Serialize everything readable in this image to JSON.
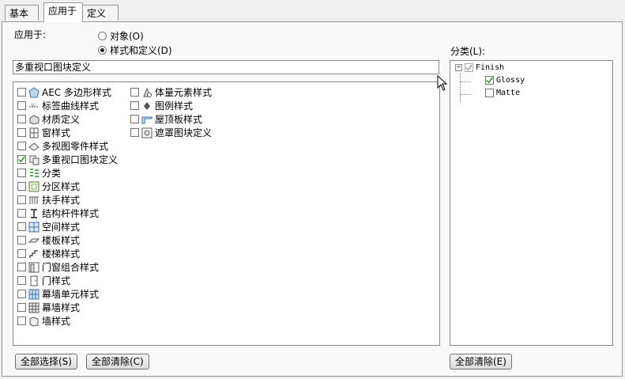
{
  "tabs": [
    {
      "label": "基本"
    },
    {
      "label": "应用于"
    },
    {
      "label": "定义"
    }
  ],
  "apply_to": {
    "label": "应用于:",
    "options": [
      {
        "label": "对象(O)",
        "selected": false
      },
      {
        "label": "样式和定义(D)",
        "selected": true
      }
    ]
  },
  "current_style": "多重视口图块定义",
  "style_list": {
    "col1": [
      {
        "label": "AEC 多边形样式",
        "checked": false,
        "icon": "polygon-icon"
      },
      {
        "label": "标签曲线样式",
        "checked": false,
        "icon": "label-curve-icon"
      },
      {
        "label": "材质定义",
        "checked": false,
        "icon": "material-icon"
      },
      {
        "label": "窗样式",
        "checked": false,
        "icon": "window-icon"
      },
      {
        "label": "多视图零件样式",
        "checked": false,
        "icon": "multiview-part-icon"
      },
      {
        "label": "多重视口图块定义",
        "checked": true,
        "icon": "mvblock-icon"
      },
      {
        "label": "分类",
        "checked": false,
        "icon": "classification-icon"
      },
      {
        "label": "分区样式",
        "checked": false,
        "icon": "zone-icon"
      },
      {
        "label": "扶手样式",
        "checked": false,
        "icon": "railing-icon"
      },
      {
        "label": "结构杆件样式",
        "checked": false,
        "icon": "structural-member-icon"
      },
      {
        "label": "空间样式",
        "checked": false,
        "icon": "space-icon"
      },
      {
        "label": "楼板样式",
        "checked": false,
        "icon": "slab-icon"
      },
      {
        "label": "楼梯样式",
        "checked": false,
        "icon": "stair-icon"
      },
      {
        "label": "门窗组合样式",
        "checked": false,
        "icon": "door-window-assembly-icon"
      },
      {
        "label": "门样式",
        "checked": false,
        "icon": "door-icon"
      },
      {
        "label": "幕墙单元样式",
        "checked": false,
        "icon": "curtain-wall-unit-icon"
      },
      {
        "label": "幕墙样式",
        "checked": false,
        "icon": "curtain-wall-icon"
      },
      {
        "label": "墙样式",
        "checked": false,
        "icon": "wall-icon"
      }
    ],
    "col2": [
      {
        "label": "体量元素样式",
        "checked": false,
        "icon": "mass-element-icon"
      },
      {
        "label": "图例样式",
        "checked": false,
        "icon": "legend-icon"
      },
      {
        "label": "屋顶板样式",
        "checked": false,
        "icon": "roof-slab-icon"
      },
      {
        "label": "遮罩图块定义",
        "checked": false,
        "icon": "mask-block-icon"
      }
    ]
  },
  "classification": {
    "label": "分类(L):",
    "root": {
      "label": "Finish",
      "checked": true,
      "expanded": true
    },
    "children": [
      {
        "label": "Glossy",
        "checked": true
      },
      {
        "label": "Matte",
        "checked": false
      }
    ]
  },
  "buttons": {
    "select_all": "全部选择(S)",
    "clear_all_left": "全部清除(C)",
    "clear_all_right": "全部清除(E)"
  },
  "colors": {
    "border": "#828790",
    "check": "#1a8a1a"
  }
}
